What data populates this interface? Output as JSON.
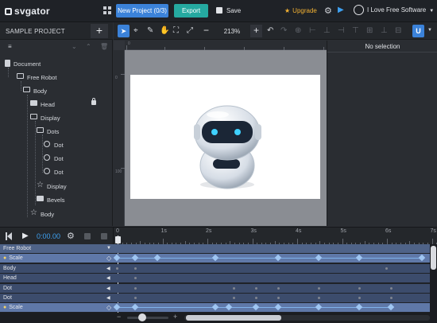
{
  "app": {
    "logo_text": "svgator",
    "project_button": "New Project (0/3)",
    "export_button": "Export",
    "save_label": "Save",
    "upgrade_label": "Upgrade",
    "user_name": "I Love Free Software"
  },
  "left_panel": {
    "title": "SAMPLE PROJECT",
    "tree": [
      {
        "label": "Document",
        "icon": "document-icon",
        "level": 0
      },
      {
        "label": "Free Robot",
        "icon": "folder-open-icon",
        "level": 1
      },
      {
        "label": "Body",
        "icon": "folder-open-icon",
        "level": 2
      },
      {
        "label": "Head",
        "icon": "folder-icon",
        "level": 3,
        "locked": true
      },
      {
        "label": "Display",
        "icon": "folder-open-icon",
        "level": 3
      },
      {
        "label": "Dots",
        "icon": "folder-open-icon",
        "level": 4
      },
      {
        "label": "Dot",
        "icon": "circle-icon",
        "level": 5
      },
      {
        "label": "Dot",
        "icon": "circle-icon",
        "level": 5
      },
      {
        "label": "Dot",
        "icon": "circle-icon",
        "level": 5
      },
      {
        "label": "Display",
        "icon": "star-icon",
        "level": 4
      },
      {
        "label": "Bevels",
        "icon": "folder-icon",
        "level": 4
      },
      {
        "label": "Body",
        "icon": "star-icon",
        "level": 3
      }
    ]
  },
  "toolbar": {
    "zoom": "213%"
  },
  "right_panel": {
    "empty_text": "No selection"
  },
  "timeline": {
    "current_time": "0:00.00",
    "ruler_labels": [
      "0",
      "1s",
      "2s",
      "3s",
      "4s",
      "5s",
      "6s",
      "7s"
    ],
    "rows": [
      {
        "name": "Free Robot",
        "type": "header"
      },
      {
        "name": "Scale",
        "type": "property",
        "keyframes": [
          0,
          0.4,
          0.9,
          2.2,
          3.6,
          4.5,
          5.4,
          6.8
        ]
      },
      {
        "name": "Body",
        "type": "group",
        "dots": [
          0,
          0.4,
          6.0
        ]
      },
      {
        "name": "Head",
        "type": "group",
        "dots": [
          0.4
        ]
      },
      {
        "name": "Dot",
        "type": "group",
        "dots": [
          0.4,
          2.6,
          3.1,
          3.6,
          4.5,
          5.4,
          6.1
        ]
      },
      {
        "name": "Dot",
        "type": "group",
        "dots": [
          0.4,
          2.6,
          3.1,
          3.6,
          4.5,
          5.4,
          6.1
        ]
      },
      {
        "name": "Scale",
        "type": "property",
        "keyframes": [
          0,
          0.4,
          2.2,
          2.5,
          3.1,
          3.6,
          4.5,
          5.4,
          6.1
        ]
      }
    ]
  }
}
